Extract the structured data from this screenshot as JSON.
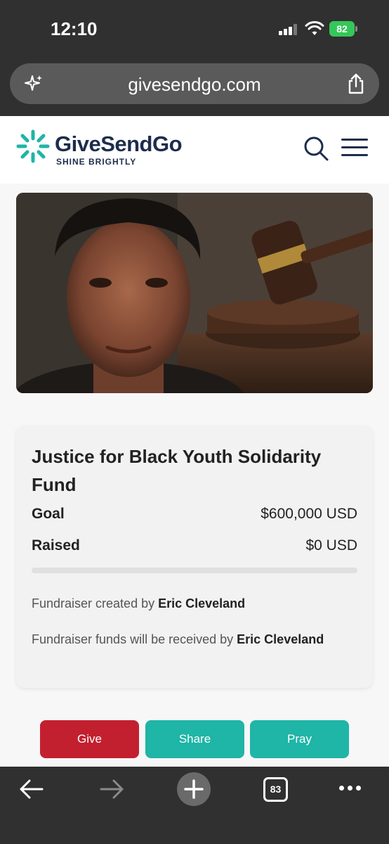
{
  "status": {
    "time": "12:10",
    "battery": "82"
  },
  "browser": {
    "url": "givesendgo.com",
    "tabs_count": "83"
  },
  "site": {
    "brand": "GiveSendGo",
    "tagline": "SHINE BRIGHTLY"
  },
  "campaign": {
    "title": "Justice for Black Youth Solidarity Fund",
    "goal_label": "Goal",
    "goal_value": "$600,000 USD",
    "raised_label": "Raised",
    "raised_value": "$0 USD",
    "progress_fraction": 0,
    "created_by_prefix": "Fundraiser created by",
    "created_by_name": "Eric Cleveland",
    "received_by_prefix": "Fundraiser funds will be received by",
    "received_by_name": "Eric Cleveland"
  },
  "actions": {
    "give": "Give",
    "share": "Share",
    "pray": "Pray"
  },
  "colors": {
    "brand_teal": "#1fb5a7",
    "give_red": "#c3202f",
    "navy": "#1d2d4c"
  }
}
